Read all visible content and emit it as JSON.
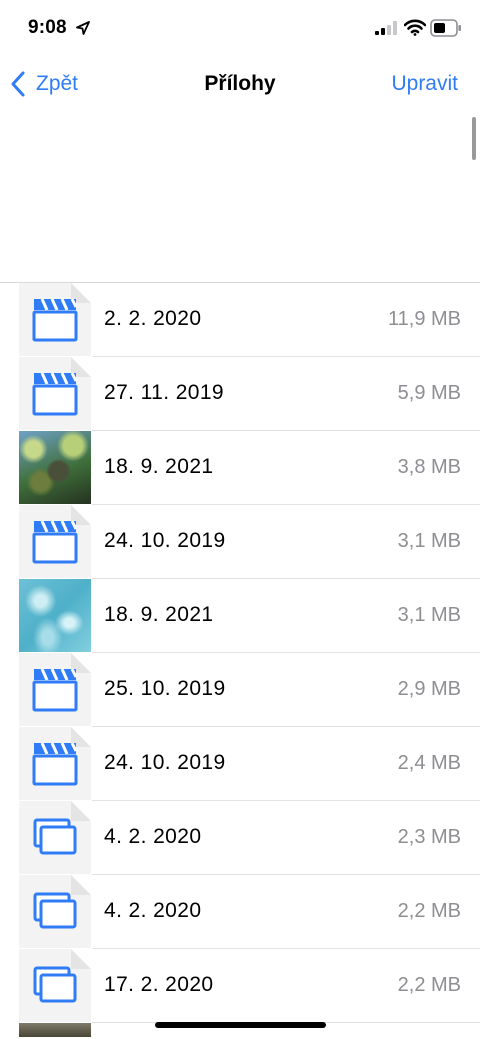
{
  "status_bar": {
    "time": "9:08",
    "icons": [
      "location-arrow-icon",
      "cellular-signal-icon",
      "wifi-icon",
      "battery-icon"
    ]
  },
  "nav": {
    "back_label": "Zpět",
    "title": "Přílohy",
    "edit_label": "Upravit"
  },
  "colors": {
    "accent": "#2f7cf6",
    "secondary_text": "#8e8e93",
    "separator": "#e2e2e2"
  },
  "attachments": [
    {
      "type": "video",
      "icon": "video-clapper-icon",
      "date": "2. 2. 2020",
      "size": "11,9 MB"
    },
    {
      "type": "video",
      "icon": "video-clapper-icon",
      "date": "27. 11. 2019",
      "size": "5,9 MB"
    },
    {
      "type": "photo",
      "icon": "photo-thumbnail",
      "date": "18. 9. 2021",
      "size": "3,8 MB"
    },
    {
      "type": "video",
      "icon": "video-clapper-icon",
      "date": "24. 10. 2019",
      "size": "3,1 MB"
    },
    {
      "type": "photo",
      "icon": "photo-thumbnail",
      "date": "18. 9. 2021",
      "size": "3,1 MB"
    },
    {
      "type": "video",
      "icon": "video-clapper-icon",
      "date": "25. 10. 2019",
      "size": "2,9 MB"
    },
    {
      "type": "video",
      "icon": "video-clapper-icon",
      "date": "24. 10. 2019",
      "size": "2,4 MB"
    },
    {
      "type": "stack",
      "icon": "image-stack-icon",
      "date": "4. 2. 2020",
      "size": "2,3 MB"
    },
    {
      "type": "stack",
      "icon": "image-stack-icon",
      "date": "4. 2. 2020",
      "size": "2,2 MB"
    },
    {
      "type": "stack",
      "icon": "image-stack-icon",
      "date": "17. 2. 2020",
      "size": "2,2 MB"
    }
  ]
}
